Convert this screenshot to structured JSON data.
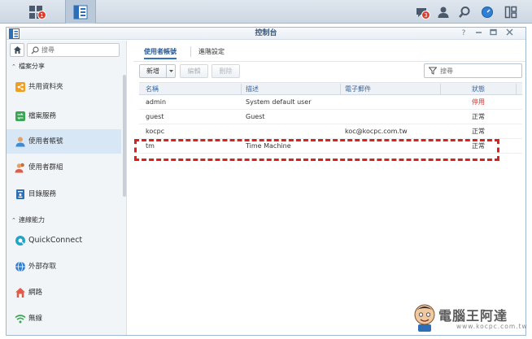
{
  "taskbar": {
    "main_menu_badge": "1",
    "notification_badge": "3"
  },
  "window": {
    "title": "控制台",
    "help_icon_label": "?"
  },
  "sidebar": {
    "search_placeholder": "搜尋",
    "sections": [
      {
        "label": "檔案分享"
      },
      {
        "label": "連線能力"
      }
    ],
    "items": [
      {
        "label": "共用資料夾",
        "icon": "shared-folder-icon"
      },
      {
        "label": "檔案服務",
        "icon": "file-services-icon"
      },
      {
        "label": "使用者帳號",
        "icon": "user-icon",
        "active": true
      },
      {
        "label": "使用者群組",
        "icon": "group-icon"
      },
      {
        "label": "目錄服務",
        "icon": "directory-icon"
      },
      {
        "label": "QuickConnect",
        "icon": "quickconnect-icon"
      },
      {
        "label": "外部存取",
        "icon": "external-access-icon"
      },
      {
        "label": "網路",
        "icon": "network-icon"
      },
      {
        "label": "無線",
        "icon": "wireless-icon"
      }
    ]
  },
  "tabs": [
    {
      "label": "使用者帳號",
      "active": true
    },
    {
      "label": "進階設定",
      "active": false
    }
  ],
  "toolbar": {
    "create_label": "新增",
    "edit_label": "編輯",
    "delete_label": "刪除",
    "filter_placeholder": "搜尋"
  },
  "table": {
    "columns": [
      "名稱",
      "描述",
      "電子郵件",
      "狀態"
    ],
    "rows": [
      {
        "name": "admin",
        "description": "System default user",
        "email": "",
        "status": "停用",
        "status_color": "#d9312c"
      },
      {
        "name": "guest",
        "description": "Guest",
        "email": "",
        "status": "正常",
        "status_color": "#333333"
      },
      {
        "name": "kocpc",
        "description": "",
        "email": "koc@kocpc.com.tw",
        "status": "正常",
        "status_color": "#333333"
      },
      {
        "name": "tm",
        "description": "Time Machine",
        "email": "",
        "status": "正常",
        "status_color": "#333333"
      }
    ]
  },
  "watermark": {
    "text": "電腦王阿達",
    "url": "www.kocpc.com.tw"
  },
  "colors": {
    "accent": "#2f73c2",
    "highlight_border": "#d8231d",
    "disabled_status": "#d9312c"
  }
}
